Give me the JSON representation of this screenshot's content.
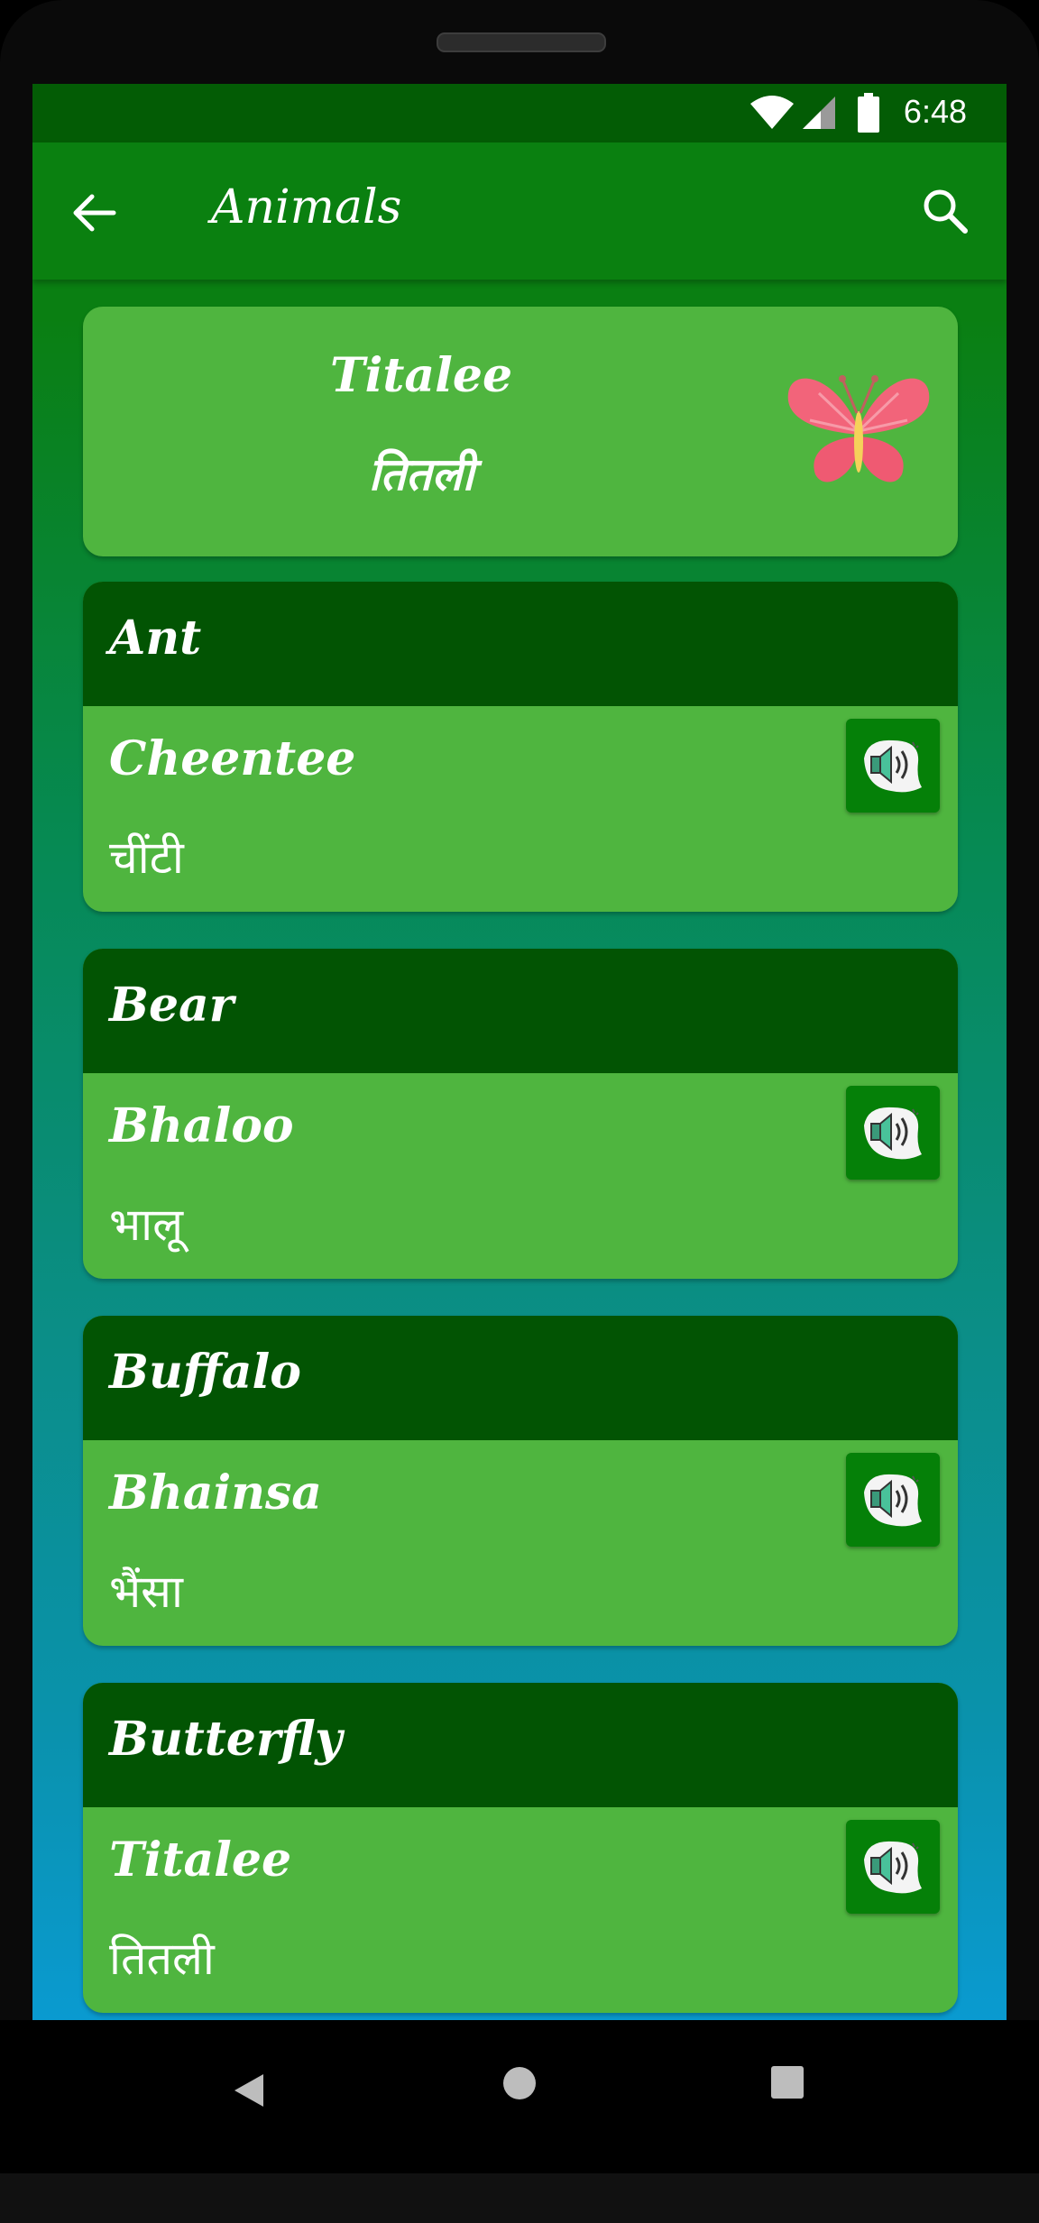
{
  "status_bar": {
    "time": "6:48",
    "icons": [
      "wifi-icon",
      "cell-signal-icon",
      "battery-icon"
    ]
  },
  "app_bar": {
    "title": "Animals",
    "back_icon": "arrow-left-icon",
    "search_icon": "search-icon",
    "background_color": "#0a8010"
  },
  "featured": {
    "transliteration": "Titalee",
    "hindi": "तितली",
    "image_icon": "butterfly-icon"
  },
  "words": [
    {
      "english": "Ant",
      "transliteration": "Cheentee",
      "hindi": "चींटी"
    },
    {
      "english": "Bear",
      "transliteration": "Bhaloo",
      "hindi": "भालू"
    },
    {
      "english": "Buffalo",
      "transliteration": "Bhainsa",
      "hindi": "भैंसा"
    },
    {
      "english": "Butterfly",
      "transliteration": "Titalee",
      "hindi": "तितली"
    }
  ],
  "colors": {
    "card_body": "#4fb53f",
    "card_header": "#025403",
    "status_bar": "#035c05",
    "speaker_button": "#058008"
  },
  "nav_bar": {
    "buttons": [
      "nav-back-icon",
      "nav-home-icon",
      "nav-recents-icon"
    ]
  }
}
